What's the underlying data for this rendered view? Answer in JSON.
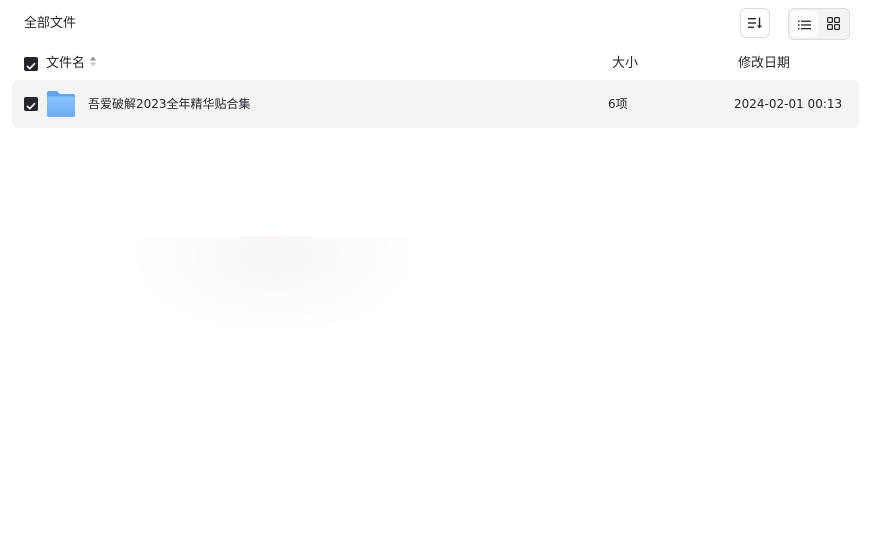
{
  "breadcrumb": {
    "label": "全部文件"
  },
  "toolbar": {
    "sort_icon": "sort-icon",
    "list_view_icon": "list-view-icon",
    "grid_view_icon": "grid-view-icon",
    "active_view": "list"
  },
  "table": {
    "columns": {
      "name": "文件名",
      "size": "大小",
      "date": "修改日期"
    },
    "select_all_checked": true,
    "rows": [
      {
        "checked": true,
        "icon": "folder-icon",
        "name": "吾爱破解2023全年精华贴合集",
        "size": "6项",
        "date": "2024-02-01 00:13"
      }
    ]
  },
  "colors": {
    "checkbox": "#25262b",
    "row_highlight": "#f4f4f5",
    "folder": "#6fb1f7"
  }
}
